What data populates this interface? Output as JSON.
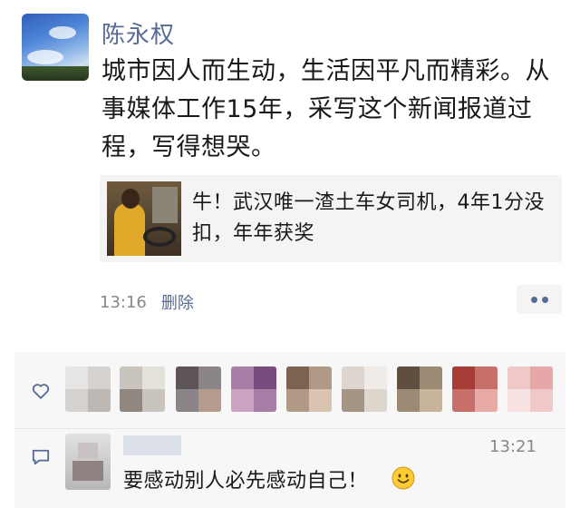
{
  "post": {
    "author": "陈永权",
    "text": "城市因人而生动，生活因平凡而精彩。从事媒体工作15年，采写这个新闻报道过程，写得想哭。",
    "link_card": {
      "title": "牛！武汉唯一渣土车女司机，4年1分没扣，年年获奖"
    },
    "time": "13:16",
    "delete_label": "删除"
  },
  "icons": {
    "like": "heart-icon",
    "comment": "comment-icon",
    "more": "more-dots-icon",
    "emoji": "smile-emoji-icon"
  },
  "likes": {
    "count_shown": 9
  },
  "comments": [
    {
      "time": "13:21",
      "text": "要感动别人必先感动自己！"
    }
  ],
  "colors": {
    "link_blue": "#576b95",
    "secondary_text": "#888888",
    "panel_bg": "#f7f7f7"
  }
}
